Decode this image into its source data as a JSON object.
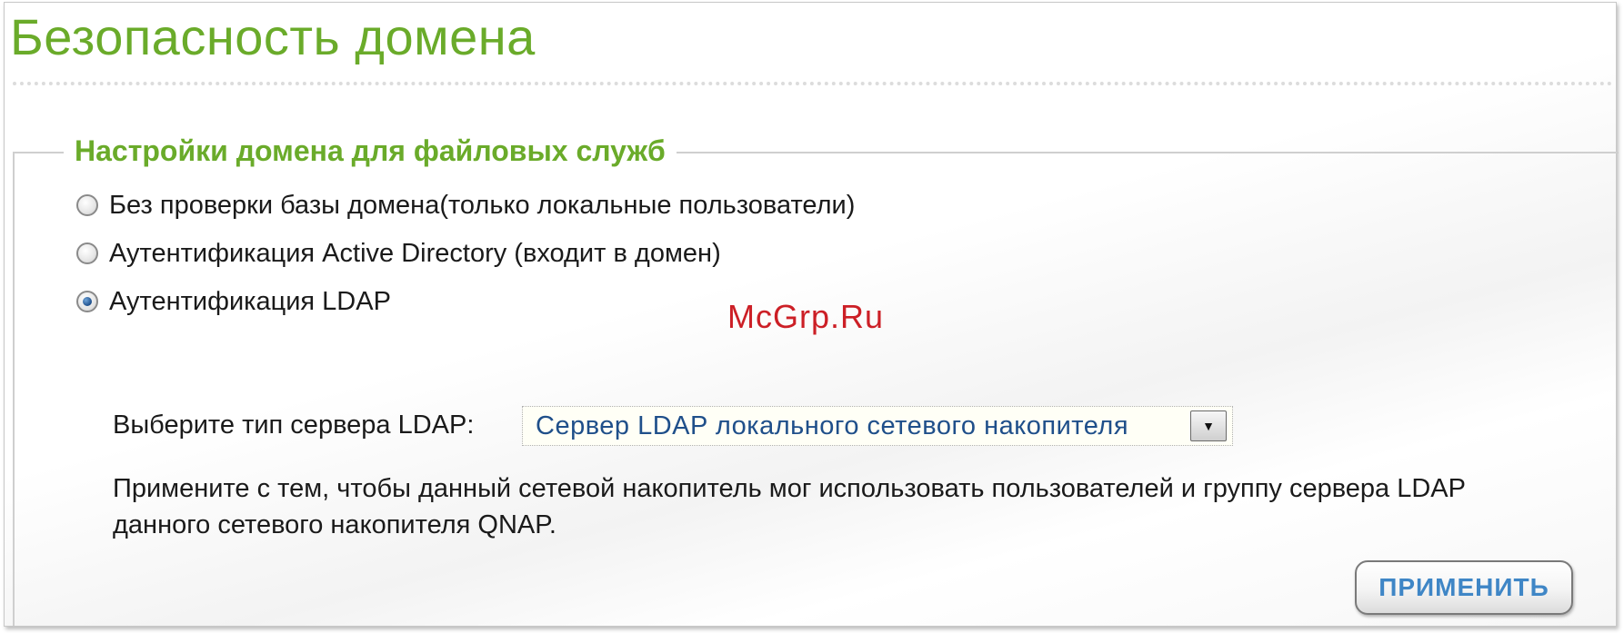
{
  "page": {
    "title": "Безопасность домена",
    "watermark": "McGrp.Ru"
  },
  "section": {
    "legend": "Настройки домена для файловых служб",
    "options": [
      {
        "label": "Без проверки базы домена(только локальные пользователи)",
        "selected": false
      },
      {
        "label": "Аутентификация Active Directory (входит в домен)",
        "selected": false
      },
      {
        "label": "Аутентификация LDAP",
        "selected": true
      }
    ]
  },
  "ldap": {
    "server_type_label": "Выберите тип сервера LDAP:",
    "server_type_value": "Сервер LDAP локального сетевого накопителя",
    "description_line1": "Примените с тем, чтобы данный сетевой накопитель мог использовать пользователей и группу сервера LDAP",
    "description_line2": "данного сетевого накопителя QNAP."
  },
  "actions": {
    "apply_label": "ПРИМЕНИТЬ"
  },
  "colors": {
    "accent_green": "#6aab2a",
    "button_text_blue": "#3f86c6",
    "watermark_red": "#cc1f26"
  },
  "icons": {
    "dropdown": "chevron-down-icon"
  }
}
